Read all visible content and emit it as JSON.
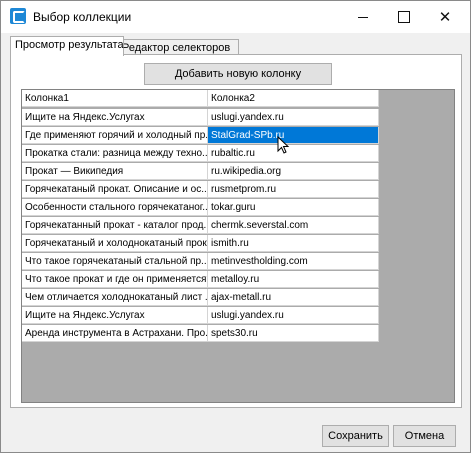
{
  "window": {
    "title": "Выбор коллекции",
    "accent_color": "#0078d7"
  },
  "tabs": [
    {
      "label": "Просмотр результата",
      "active": true
    },
    {
      "label": "Редактор селекторов",
      "active": false
    }
  ],
  "toolbar": {
    "add_column_label": "Добавить новую колонку"
  },
  "table": {
    "columns": [
      "Колонка1",
      "Колонка2"
    ],
    "selected_row": 1,
    "rows": [
      [
        "Ищите на Яндекс.Услугах",
        "uslugi.yandex.ru"
      ],
      [
        "Где применяют горячий и холодный пр...",
        "StalGrad-SPb.ru"
      ],
      [
        "Прокатка стали: разница между техно...",
        "rubaltic.ru"
      ],
      [
        "Прокат — Википедия",
        "ru.wikipedia.org"
      ],
      [
        "Горячекатаный прокат. Описание и ос...",
        "rusmetprom.ru"
      ],
      [
        "Особенности стального горячекатаног...",
        "tokar.guru"
      ],
      [
        "Горячекатанный прокат - каталог прод...",
        "chermk.severstal.com"
      ],
      [
        "Горячекатаный и холоднокатаный прок...",
        "ismith.ru"
      ],
      [
        "Что такое горячекатаный стальной пр...",
        "metinvestholding.com"
      ],
      [
        "Что такое прокат и где он применяется?",
        "metalloy.ru"
      ],
      [
        "Чем отличается холоднокатаный лист ...",
        "ajax-metall.ru"
      ],
      [
        "Ищите на Яндекс.Услугах",
        "uslugi.yandex.ru"
      ],
      [
        "Аренда инструмента в Астрахани. Про...",
        "spets30.ru"
      ]
    ]
  },
  "footer": {
    "save_label": "Сохранить",
    "cancel_label": "Отмена"
  }
}
